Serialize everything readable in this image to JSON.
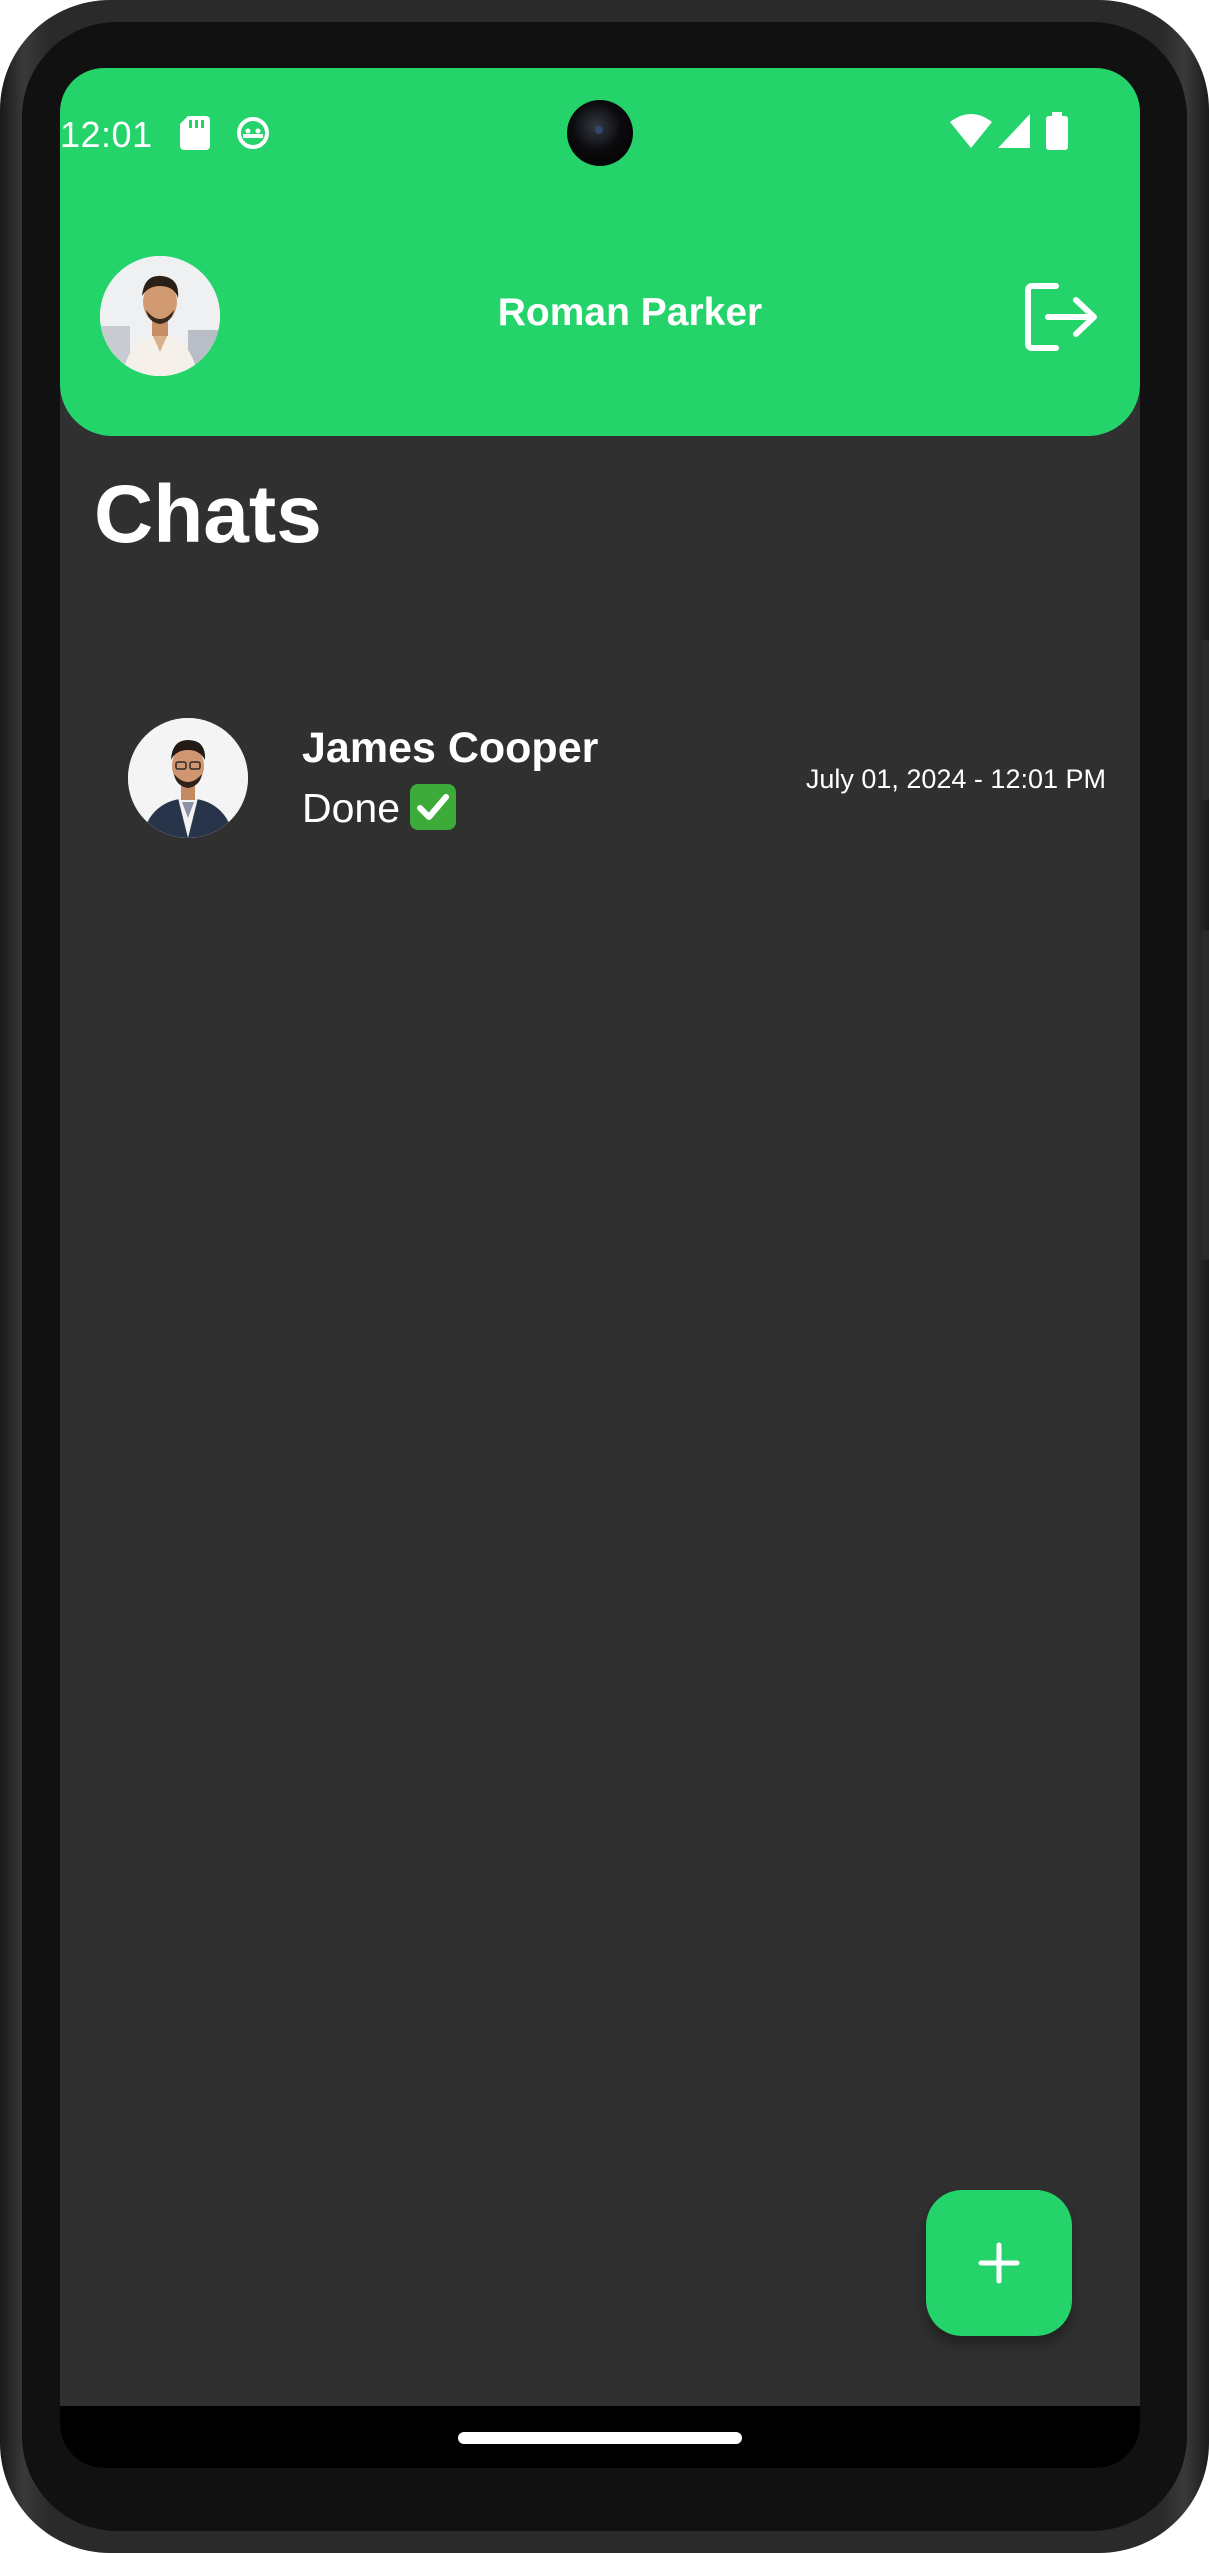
{
  "status_bar": {
    "time": "12:01",
    "icons": [
      "sd-card-icon",
      "android-debug-icon",
      "wifi-icon",
      "signal-icon",
      "battery-icon"
    ]
  },
  "header": {
    "title": "Roman Parker",
    "profile_avatar": "profile-photo",
    "logout_icon": "logout-icon",
    "background_color": "#25d36b"
  },
  "main": {
    "section_title": "Chats",
    "chats": [
      {
        "name": "James Cooper",
        "last_message": "Done",
        "last_message_emoji": "✅",
        "timestamp": "July 01, 2024 - 12:01 PM",
        "avatar": "contact-photo"
      }
    ]
  },
  "fab": {
    "icon": "plus-icon",
    "color": "#25d36b"
  },
  "colors": {
    "accent": "#25d36b",
    "background": "#303030",
    "text": "#ffffff"
  }
}
